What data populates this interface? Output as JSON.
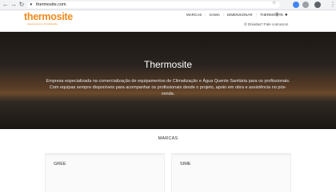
{
  "browser": {
    "url": "thermosite.com",
    "back_icon": "arrow-left-icon",
    "forward_icon": "arrow-right-icon",
    "reload_icon": "reload-icon"
  },
  "header": {
    "logo": "thermosite",
    "tagline": "Aquecimento e Climatização",
    "nav": [
      "MARCAS",
      "GAMA",
      "DIMENSIONAR",
      "THERMOSITE"
    ],
    "contact": "Dúvidas? Fale connosco!"
  },
  "hero": {
    "title": "Thermosite",
    "description": "Empresa especializada na comercialização de equipamentos de Climatização e Água Quente Sanitária para os profissionais. Com equipas sempre disponíveis para acompanhar os profissionais desde o projeto, apoio em obra e assistência no pós-venda."
  },
  "brands": {
    "heading": "MARCAS",
    "items": [
      "GREE",
      "SIME"
    ]
  },
  "colors": {
    "brand_orange": "#f08a1c",
    "hero_dark": "#1b1713"
  }
}
